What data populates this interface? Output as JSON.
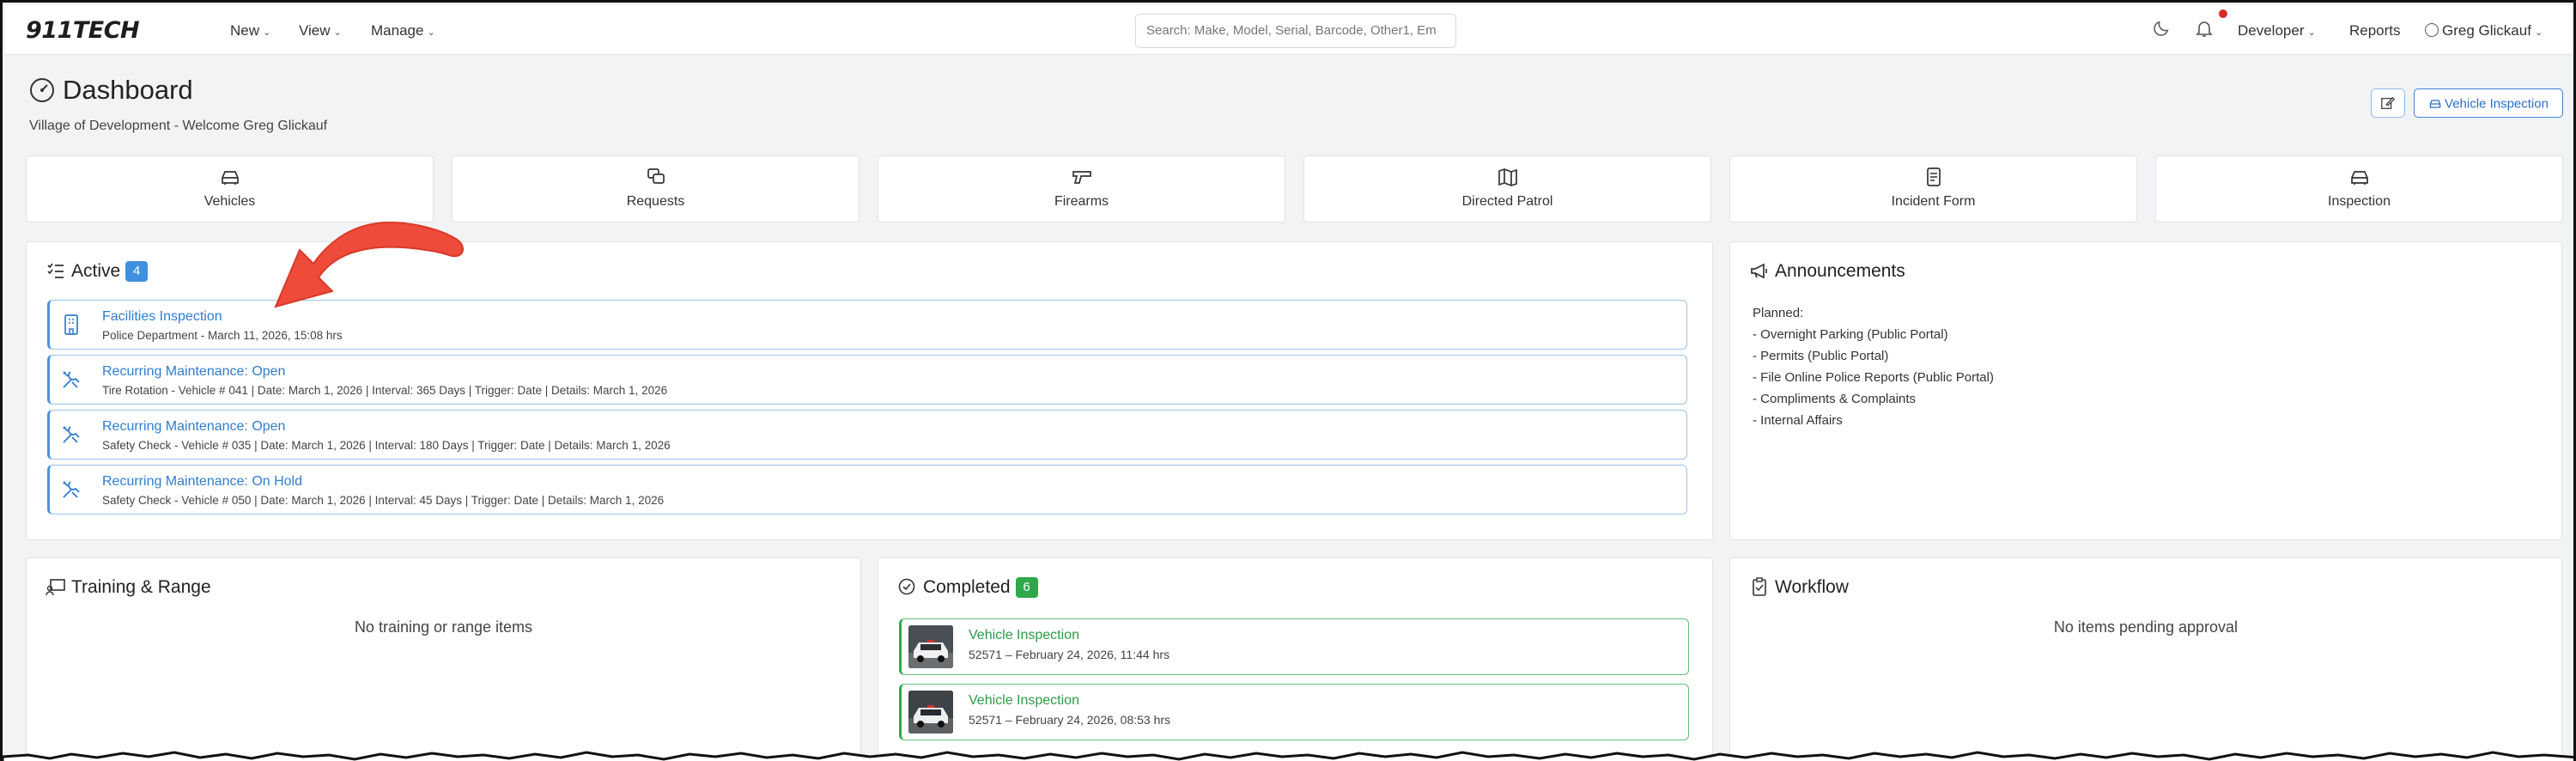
{
  "navbar": {
    "logo": "911TECH",
    "menu": [
      {
        "label": "New"
      },
      {
        "label": "View"
      },
      {
        "label": "Manage"
      }
    ],
    "search_placeholder": "Search: Make, Model, Serial, Barcode, Other1, Em",
    "developer_label": "Developer",
    "reports_label": "Reports",
    "user_label": "Greg Glickauf"
  },
  "header": {
    "title": "Dashboard",
    "subtitle": "Village of Development - Welcome Greg Glickauf",
    "vehicle_inspection_button": "Vehicle Inspection"
  },
  "tiles": [
    {
      "label": "Vehicles",
      "icon": "car-icon"
    },
    {
      "label": "Requests",
      "icon": "requests-icon"
    },
    {
      "label": "Firearms",
      "icon": "gun-icon"
    },
    {
      "label": "Directed Patrol",
      "icon": "map-icon"
    },
    {
      "label": "Incident Form",
      "icon": "form-icon"
    },
    {
      "label": "Inspection",
      "icon": "car-icon"
    }
  ],
  "active": {
    "title": "Active",
    "count": "4",
    "items": [
      {
        "title": "Facilities Inspection",
        "subtitle": "Police Department - March 11, 2026, 15:08 hrs",
        "icon": "building-icon"
      },
      {
        "title": "Recurring Maintenance: Open",
        "subtitle": "Tire Rotation - Vehicle # 041 | Date: March 1, 2026 | Interval: 365 Days | Trigger: Date | Details: March 1, 2026",
        "icon": "tools-icon"
      },
      {
        "title": "Recurring Maintenance: Open",
        "subtitle": "Safety Check - Vehicle # 035 | Date: March 1, 2026 | Interval: 180 Days | Trigger: Date | Details: March 1, 2026",
        "icon": "tools-icon"
      },
      {
        "title": "Recurring Maintenance: On Hold",
        "subtitle": "Safety Check - Vehicle # 050 | Date: March 1, 2026 | Interval: 45 Days | Trigger: Date | Details: March 1, 2026",
        "icon": "tools-icon"
      }
    ]
  },
  "announcements": {
    "title": "Announcements",
    "lines": [
      "Planned:",
      "- Overnight Parking (Public Portal)",
      "- Permits (Public Portal)",
      "- File Online Police Reports (Public Portal)",
      "- Compliments & Complaints",
      "- Internal Affairs"
    ]
  },
  "training": {
    "title": "Training & Range",
    "empty": "No training or range items"
  },
  "completed": {
    "title": "Completed",
    "count": "6",
    "items": [
      {
        "title": "Vehicle Inspection",
        "subtitle": "52571 – February 24, 2026, 11:44 hrs"
      },
      {
        "title": "Vehicle Inspection",
        "subtitle": "52571 – February 24, 2026, 08:53 hrs"
      }
    ]
  },
  "workflow": {
    "title": "Workflow",
    "empty": "No items pending approval"
  },
  "colors": {
    "accent_blue": "#2f7dcf",
    "success_green": "#2ea84a",
    "annotation_red": "#ef4b3a"
  }
}
